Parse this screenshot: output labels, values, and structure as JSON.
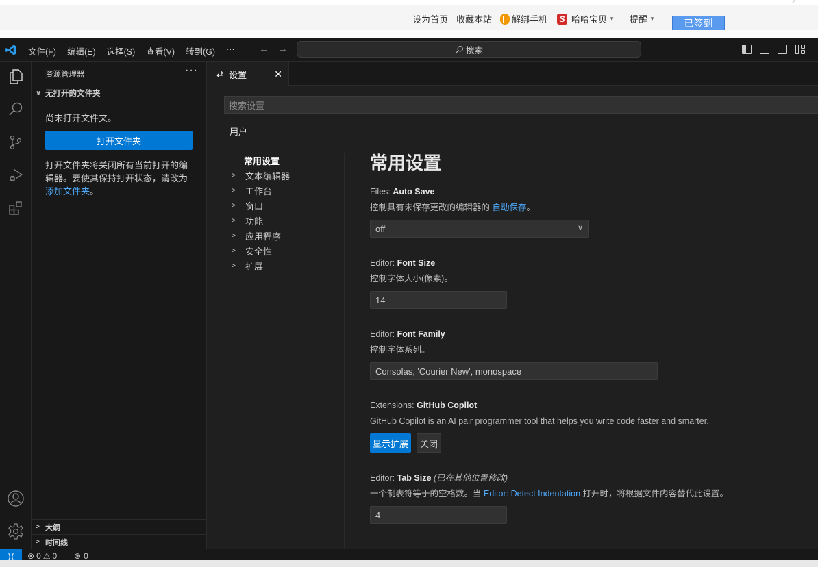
{
  "browser": {
    "site_links": [
      "设为首页",
      "收藏本站",
      "解绑手机",
      "哈哈宝贝",
      "提醒"
    ],
    "signed_in_button": "已签到"
  },
  "titlebar": {
    "menu": [
      "文件(F)",
      "编辑(E)",
      "选择(S)",
      "查看(V)",
      "转到(G)",
      "···"
    ],
    "back_arrow": "←",
    "forward_arrow": "→",
    "search_placeholder": "搜索"
  },
  "activitybar": {
    "items": [
      "explorer-icon",
      "search-icon",
      "source-control-icon",
      "run-debug-icon",
      "extensions-icon"
    ],
    "bottom": [
      "account-icon",
      "manage-gear-icon"
    ]
  },
  "sidebar": {
    "title": "资源管理器",
    "more": "···",
    "section": "无打开的文件夹",
    "empty_text": "尚未打开文件夹。",
    "open_folder_button": "打开文件夹",
    "desc": "打开文件夹将关闭所有当前打开的编辑器。要使其保持打开状态，请改为",
    "desc_link": "添加文件夹",
    "desc_end": "。",
    "outline": "大纲",
    "timeline": "时间线"
  },
  "editor": {
    "tab_label": "设置",
    "search_placeholder": "搜索设置",
    "scope_tab": "用户",
    "toc": [
      {
        "label": "常用设置",
        "active": true
      },
      {
        "label": "文本编辑器"
      },
      {
        "label": "工作台"
      },
      {
        "label": "窗口"
      },
      {
        "label": "功能"
      },
      {
        "label": "应用程序"
      },
      {
        "label": "安全性"
      },
      {
        "label": "扩展"
      }
    ],
    "heading": "常用设置",
    "settings": {
      "auto_save": {
        "category": "Files: ",
        "name": "Auto Save",
        "desc": "控制具有未保存更改的编辑器的 ",
        "desc_link": "自动保存",
        "desc_end": "。",
        "value": "off"
      },
      "font_size": {
        "category": "Editor: ",
        "name": "Font Size",
        "desc": "控制字体大小(像素)。",
        "value": "14"
      },
      "font_family": {
        "category": "Editor: ",
        "name": "Font Family",
        "desc": "控制字体系列。",
        "value": "Consolas, 'Courier New', monospace"
      },
      "copilot": {
        "category": "Extensions: ",
        "name": "GitHub Copilot",
        "desc": "GitHub Copilot is an AI pair programmer tool that helps you write code faster and smarter.",
        "primary_button": "显示扩展",
        "secondary_button": "关闭"
      },
      "tab_size": {
        "category": "Editor: ",
        "name": "Tab Size",
        "modified": "(已在其他位置修改)",
        "desc": "一个制表符等于的空格数。当 ",
        "desc_link": "Editor: Detect Indentation",
        "desc_end": " 打开时，将根据文件内容替代此设置。",
        "value": "4"
      }
    }
  },
  "statusbar": {
    "errors": "0",
    "warnings": "0",
    "ports": "0"
  },
  "colors": {
    "accent": "#0078d4",
    "link": "#4daafc",
    "background": "#1f1f1f",
    "sidebar": "#181818"
  }
}
